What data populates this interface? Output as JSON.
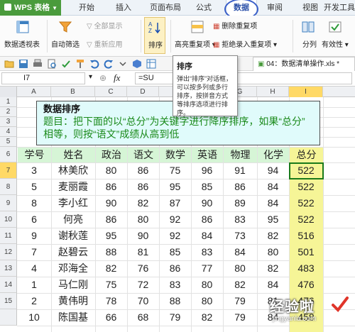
{
  "app": {
    "title": "WPS 表格"
  },
  "menu": {
    "tabs": [
      "开始",
      "插入",
      "页面布局",
      "公式",
      "数据",
      "审阅",
      "视图",
      "开发工具"
    ],
    "active": "数据"
  },
  "ribbon": {
    "pivot_label": "数据透视表",
    "autofilter_label": "自动筛选",
    "show_all_label": "全部显示",
    "reapply_label": "重新应用",
    "sort_label": "排序",
    "highlight_dup_label": "高亮重复项",
    "delete_dup_label": "删除重复项",
    "reject_dup_label": "拒绝录入重复项",
    "split_label": "分列",
    "validity_label": "有效性"
  },
  "file_tab": {
    "label": "04：数据清单操作.xls *"
  },
  "formula_bar": {
    "cell_ref": "I7",
    "fx": "fx",
    "formula": "=SU"
  },
  "tooltip": {
    "title": "排序",
    "body": "弹出“排序”对话框，可以按多列或多行排序，按拼音方式等排序选项进行排序。"
  },
  "columns": [
    "A",
    "B",
    "C",
    "D",
    "E",
    "F",
    "G",
    "H",
    "I"
  ],
  "selected_column": "I",
  "rows": [
    "1",
    "2",
    "3",
    "4",
    "5",
    "6",
    "7",
    "8",
    "9",
    "10",
    "11",
    "12",
    "13",
    "14",
    "15"
  ],
  "selected_row": "7",
  "description": {
    "title": "数据排序",
    "line1": "题目：把下面的以“总分”为关键字进行降序排序，如果“总分”",
    "line2": "相等，则按“语文”成绩从高到低"
  },
  "table": {
    "headers": [
      "学号",
      "姓名",
      "政治",
      "语文",
      "数学",
      "英语",
      "物理",
      "化学",
      "总分"
    ],
    "rows": [
      [
        "3",
        "林美欣",
        "80",
        "86",
        "75",
        "96",
        "91",
        "94",
        "522"
      ],
      [
        "5",
        "麦丽霞",
        "86",
        "86",
        "95",
        "85",
        "86",
        "84",
        "522"
      ],
      [
        "8",
        "李小红",
        "90",
        "82",
        "87",
        "90",
        "89",
        "84",
        "522"
      ],
      [
        "6",
        "何亮",
        "86",
        "80",
        "92",
        "86",
        "83",
        "95",
        "522"
      ],
      [
        "9",
        "谢秋莲",
        "95",
        "90",
        "92",
        "84",
        "73",
        "82",
        "516"
      ],
      [
        "7",
        "赵碧云",
        "88",
        "81",
        "85",
        "83",
        "84",
        "80",
        "501"
      ],
      [
        "4",
        "邓海全",
        "82",
        "76",
        "86",
        "77",
        "80",
        "82",
        "483"
      ],
      [
        "1",
        "马仁刚",
        "75",
        "72",
        "83",
        "80",
        "82",
        "84",
        "476"
      ],
      [
        "2",
        "黄伟明",
        "78",
        "70",
        "88",
        "80",
        "79",
        "81",
        "476"
      ],
      [
        "10",
        "陈国基",
        "66",
        "68",
        "79",
        "82",
        "79",
        "84",
        "458"
      ]
    ]
  },
  "watermark": {
    "text": "经验啦",
    "url": "jingyanla.com"
  },
  "colors": {
    "accent_green": "#4a9b3c",
    "total_fill": "#f6f597",
    "header_fill": "#d6f5d6",
    "desc_fill": "#e0fbfb"
  }
}
